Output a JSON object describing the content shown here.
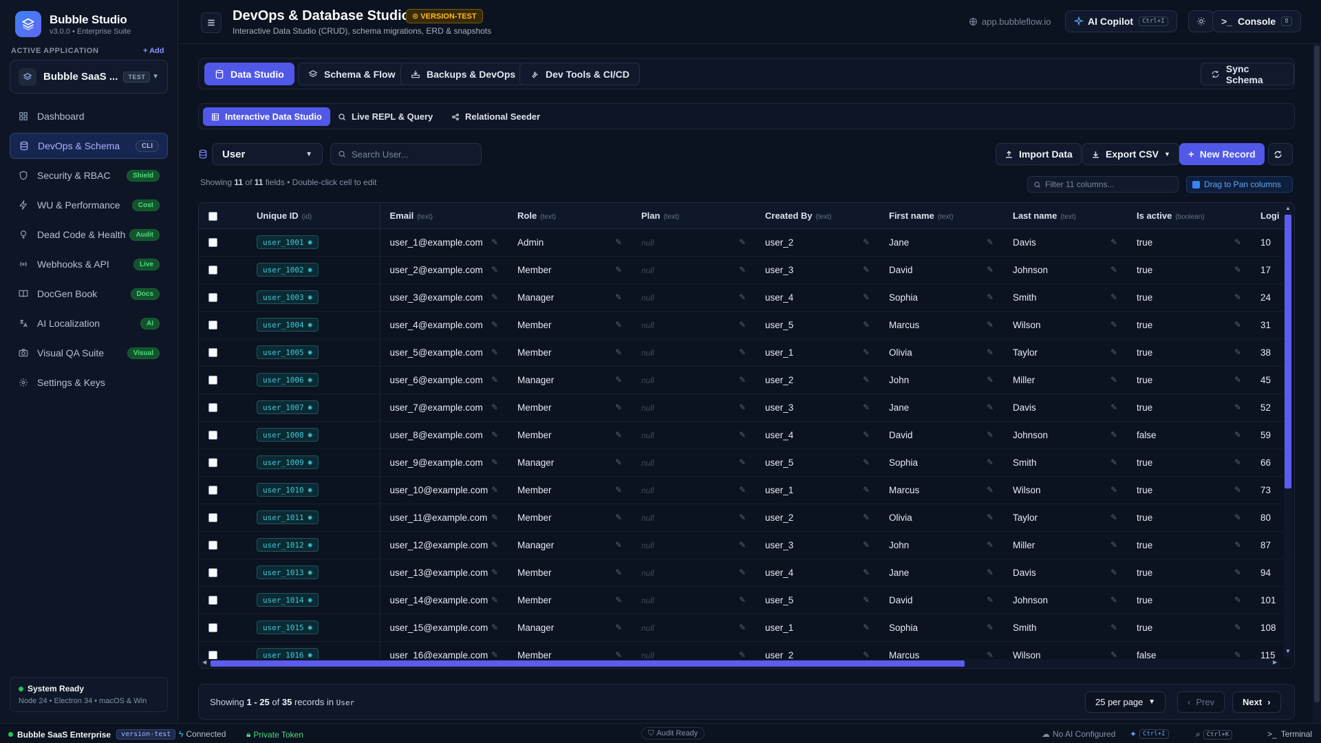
{
  "brand": {
    "title": "Bubble Studio",
    "subtitle": "v3.0.0 • Enterprise Suite"
  },
  "sidebar": {
    "section_label": "ACTIVE APPLICATION",
    "add_label": "+ Add",
    "app": {
      "name": "Bubble SaaS ...",
      "badge": "TEST"
    },
    "items": [
      {
        "label": "Dashboard",
        "icon": "dashboard-icon",
        "badge": ""
      },
      {
        "label": "DevOps & Schema",
        "icon": "database-icon",
        "badge": "CLI",
        "active": true
      },
      {
        "label": "Security & RBAC",
        "icon": "shield-icon",
        "badge": "Shield"
      },
      {
        "label": "WU & Performance",
        "icon": "lightning-icon",
        "badge": "Cost"
      },
      {
        "label": "Dead Code & Health",
        "icon": "health-icon",
        "badge": "Audit"
      },
      {
        "label": "Webhooks & API",
        "icon": "broadcast-icon",
        "badge": "Live"
      },
      {
        "label": "DocGen Book",
        "icon": "book-icon",
        "badge": "Docs"
      },
      {
        "label": "AI Localization",
        "icon": "translate-icon",
        "badge": "AI"
      },
      {
        "label": "Visual QA Suite",
        "icon": "camera-icon",
        "badge": "Visual"
      },
      {
        "label": "Settings & Keys",
        "icon": "gear-icon",
        "badge": ""
      }
    ],
    "system": {
      "title": "System Ready",
      "subtitle": "Node 24 • Electron 34 • macOS & Win"
    }
  },
  "header": {
    "title": "DevOps & Database Studio",
    "version_badge": "VERSION-TEST",
    "subtitle": "Interactive Data Studio (CRUD), schema migrations, ERD & snapshots",
    "url": "app.bubbleflow.io",
    "copilot_label": "AI Copilot",
    "copilot_kbd": "Ctrl+I",
    "console_label": "Console",
    "console_count": "8"
  },
  "main_tabs": [
    {
      "label": "Data Studio",
      "active": true
    },
    {
      "label": "Schema & Flow"
    },
    {
      "label": "Backups & DevOps"
    },
    {
      "label": "Dev Tools & CI/CD"
    }
  ],
  "sync_label": "Sync Schema",
  "sub_tabs": [
    {
      "label": "Interactive Data Studio",
      "active": true
    },
    {
      "label": "Live REPL & Query"
    },
    {
      "label": "Relational Seeder"
    }
  ],
  "toolbar": {
    "table": "User",
    "search_placeholder": "Search User...",
    "import_label": "Import Data",
    "export_label": "Export CSV",
    "new_label": "New Record"
  },
  "info": {
    "prefix": "Showing",
    "shown": "11",
    "of": "of",
    "total": "11",
    "suffix": "fields • Double-click cell to edit"
  },
  "column_filter_placeholder": "Filter 11 columns...",
  "pan_hint": "Drag to Pan columns",
  "columns": [
    {
      "name": "Unique ID",
      "type": "(id)"
    },
    {
      "name": "Email",
      "type": "(text)"
    },
    {
      "name": "Role",
      "type": "(text)"
    },
    {
      "name": "Plan",
      "type": "(text)"
    },
    {
      "name": "Created By",
      "type": "(text)"
    },
    {
      "name": "First name",
      "type": "(text)"
    },
    {
      "name": "Last name",
      "type": "(text)"
    },
    {
      "name": "Is active",
      "type": "(boolean)"
    },
    {
      "name": "Logi",
      "type": ""
    }
  ],
  "null_text": "null",
  "rows": [
    [
      "user_1001",
      "user_1@example.com",
      "Admin",
      "user_2",
      "Jane",
      "Davis",
      "true",
      "10"
    ],
    [
      "user_1002",
      "user_2@example.com",
      "Member",
      "user_3",
      "David",
      "Johnson",
      "true",
      "17"
    ],
    [
      "user_1003",
      "user_3@example.com",
      "Manager",
      "user_4",
      "Sophia",
      "Smith",
      "true",
      "24"
    ],
    [
      "user_1004",
      "user_4@example.com",
      "Member",
      "user_5",
      "Marcus",
      "Wilson",
      "true",
      "31"
    ],
    [
      "user_1005",
      "user_5@example.com",
      "Member",
      "user_1",
      "Olivia",
      "Taylor",
      "true",
      "38"
    ],
    [
      "user_1006",
      "user_6@example.com",
      "Manager",
      "user_2",
      "John",
      "Miller",
      "true",
      "45"
    ],
    [
      "user_1007",
      "user_7@example.com",
      "Member",
      "user_3",
      "Jane",
      "Davis",
      "true",
      "52"
    ],
    [
      "user_1008",
      "user_8@example.com",
      "Member",
      "user_4",
      "David",
      "Johnson",
      "false",
      "59"
    ],
    [
      "user_1009",
      "user_9@example.com",
      "Manager",
      "user_5",
      "Sophia",
      "Smith",
      "true",
      "66"
    ],
    [
      "user_1010",
      "user_10@example.com",
      "Member",
      "user_1",
      "Marcus",
      "Wilson",
      "true",
      "73"
    ],
    [
      "user_1011",
      "user_11@example.com",
      "Member",
      "user_2",
      "Olivia",
      "Taylor",
      "true",
      "80"
    ],
    [
      "user_1012",
      "user_12@example.com",
      "Manager",
      "user_3",
      "John",
      "Miller",
      "true",
      "87"
    ],
    [
      "user_1013",
      "user_13@example.com",
      "Member",
      "user_4",
      "Jane",
      "Davis",
      "true",
      "94"
    ],
    [
      "user_1014",
      "user_14@example.com",
      "Member",
      "user_5",
      "David",
      "Johnson",
      "true",
      "101"
    ],
    [
      "user_1015",
      "user_15@example.com",
      "Manager",
      "user_1",
      "Sophia",
      "Smith",
      "true",
      "108"
    ],
    [
      "user_1016",
      "user_16@example.com",
      "Member",
      "user_2",
      "Marcus",
      "Wilson",
      "false",
      "115"
    ]
  ],
  "pager": {
    "prefix": "Showing",
    "range": "1 - 25",
    "of": "of",
    "total": "35",
    "suffix": "records in",
    "table": "User",
    "per_page": "25 per page",
    "prev": "Prev",
    "next": "Next"
  },
  "statusbar": {
    "app": "Bubble SaaS Enterprise",
    "env": "version-test",
    "connected": "Connected",
    "token": "Private Token",
    "audit": "Audit Ready",
    "ai": "No AI Configured",
    "ai_kbd": "Ctrl+I",
    "search_kbd": "Ctrl+K",
    "terminal": "Terminal"
  },
  "colors": {
    "accent": "#5158e8",
    "success": "#22c55e",
    "warning": "#fbbf24",
    "id_text": "#3fc9d6"
  }
}
